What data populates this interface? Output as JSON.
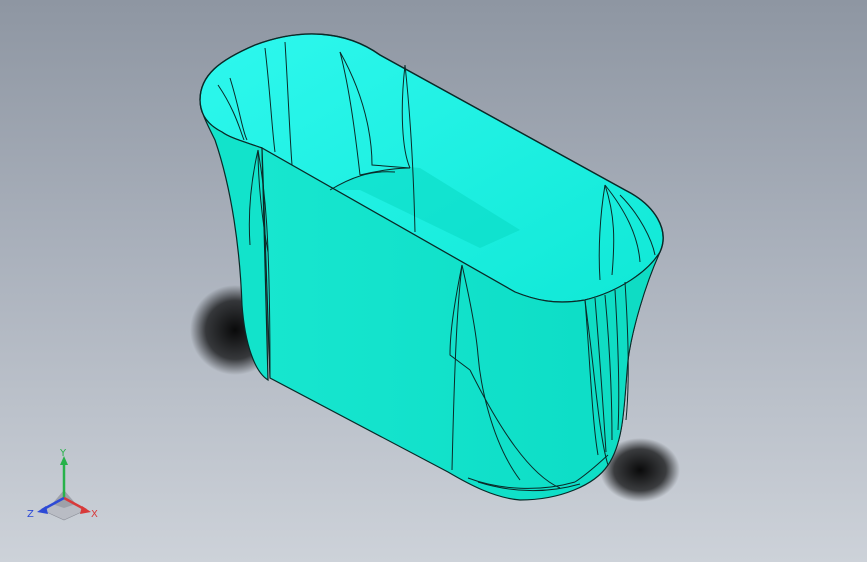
{
  "scene": {
    "body_color": "#0ee0c6",
    "inner_color": "#1ef4e4",
    "edge_color": "#0a2a28",
    "background_top": "#8e96a2",
    "background_bottom": "#cdd2d9"
  },
  "triad": {
    "x_label": "X",
    "y_label": "Y",
    "z_label": "Z",
    "x_color": "#d83a3a",
    "y_color": "#27b24a",
    "z_color": "#2d4ad6"
  }
}
